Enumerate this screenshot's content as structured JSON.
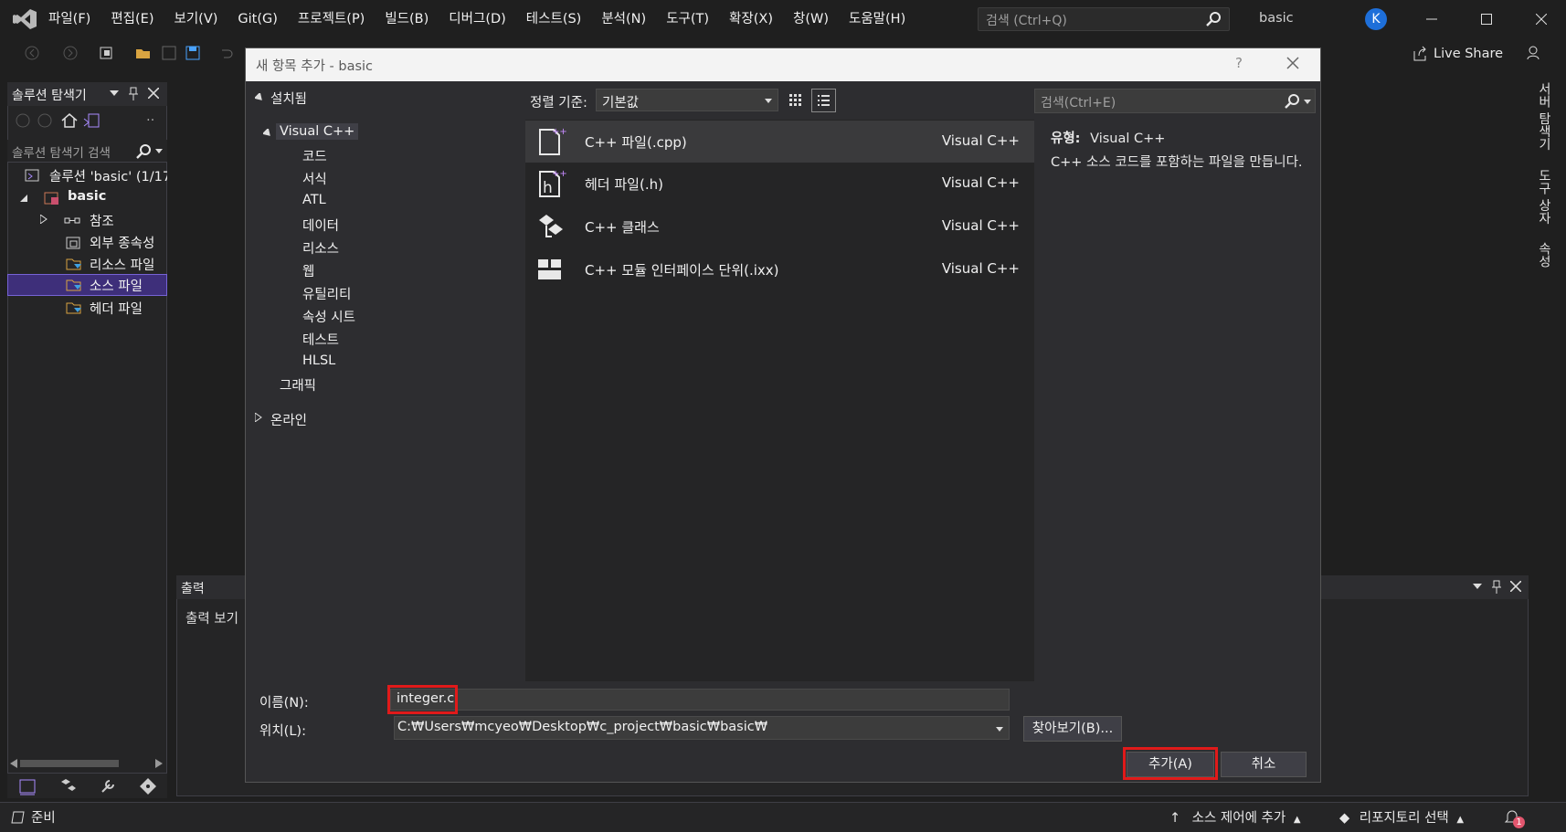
{
  "app": {
    "menu": [
      "파일(F)",
      "편집(E)",
      "보기(V)",
      "Git(G)",
      "프로젝트(P)",
      "빌드(B)",
      "디버그(D)",
      "테스트(S)",
      "분석(N)",
      "도구(T)",
      "확장(X)",
      "창(W)",
      "도움말(H)"
    ],
    "search_placeholder": "검색 (Ctrl+Q)",
    "project_name": "basic",
    "avatar_initial": "K",
    "live_share": "Live Share",
    "accent_color": "#7663d6"
  },
  "solution_explorer": {
    "title": "솔루션 탐색기",
    "search_placeholder": "솔루션 탐색기 검색",
    "tree": [
      {
        "label": "솔루션 'basic' (1/17",
        "icon": "solution-icon"
      },
      {
        "label": "basic",
        "icon": "project-icon"
      },
      {
        "label": "참조",
        "icon": "references-icon"
      },
      {
        "label": "외부 종속성",
        "icon": "external-deps-icon"
      },
      {
        "label": "리소스 파일",
        "icon": "folder-filter-icon"
      },
      {
        "label": "소스 파일",
        "icon": "folder-filter-icon",
        "selected": true
      },
      {
        "label": "헤더 파일",
        "icon": "folder-filter-icon"
      }
    ]
  },
  "output": {
    "title": "출력",
    "show_label": "출력 보기"
  },
  "right_tabs": [
    "서버 탐색기",
    "도구 상자",
    "속성"
  ],
  "status": {
    "ready": "준비",
    "source_control": "소스 제어에 추가",
    "repo": "리포지토리 선택",
    "notification_count": "1"
  },
  "dialog": {
    "title": "새 항목 추가 - basic",
    "help": "?",
    "installed": "설치됨",
    "categories": {
      "root": "Visual C++",
      "children": [
        "코드",
        "서식",
        "ATL",
        "데이터",
        "리소스",
        "웹",
        "유틸리티",
        "속성 시트",
        "테스트",
        "HLSL"
      ],
      "graphics": "그래픽",
      "online": "온라인"
    },
    "sort_label": "정렬 기준:",
    "sort_value": "기본값",
    "search_placeholder": "검색(Ctrl+E)",
    "templates": [
      {
        "name": "C++ 파일(.cpp)",
        "lang": "Visual C++",
        "icon": "cpp-file-icon",
        "selected": true
      },
      {
        "name": "헤더 파일(.h)",
        "lang": "Visual C++",
        "icon": "header-file-icon"
      },
      {
        "name": "C++ 클래스",
        "lang": "Visual C++",
        "icon": "cpp-class-icon"
      },
      {
        "name": "C++ 모듈 인터페이스 단위(.ixx)",
        "lang": "Visual C++",
        "icon": "module-icon"
      }
    ],
    "detail": {
      "type_label": "유형:",
      "type_value": "Visual C++",
      "description": "C++ 소스 코드를 포함하는 파일을 만듭니다."
    },
    "name_label": "이름(N):",
    "name_value": "integer.c",
    "location_label": "위치(L):",
    "location_value": "C:₩Users₩mcyeo₩Desktop₩c_project₩basic₩basic₩",
    "browse_button": "찾아보기(B)...",
    "add_button": "추가(A)",
    "cancel_button": "취소",
    "highlight_color": "#e01a1a"
  }
}
